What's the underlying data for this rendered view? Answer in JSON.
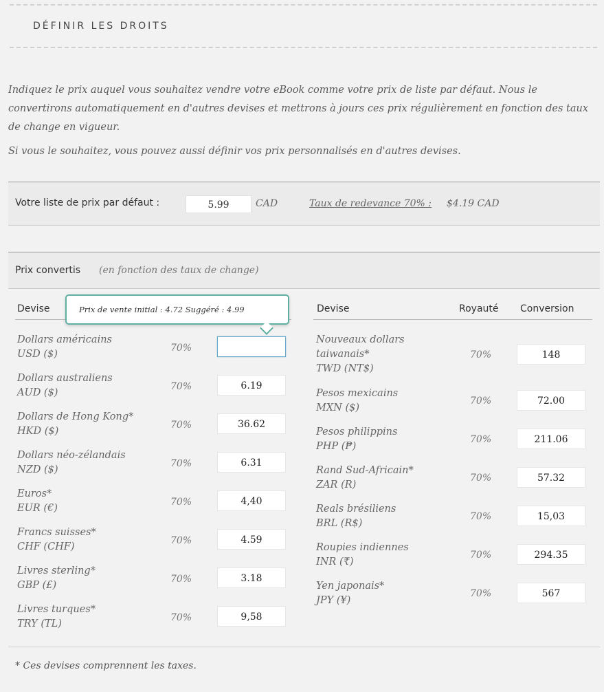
{
  "header": {
    "title": "DÉFINIR LES DROITS"
  },
  "intro": {
    "p1": "Indiquez le prix auquel vous souhaitez vendre votre eBook comme votre prix de liste par défaut. Nous le convertirons automatiquement en d'autres devises et mettrons à jours ces prix régulièrement en fonction des taux de change en vigueur.",
    "p2": "Si vous le souhaitez, vous pouvez aussi définir vos prix personnalisés en d'autres devises."
  },
  "default_price": {
    "label": "Votre liste de prix par défaut :",
    "value": "5.99",
    "currency": "CAD",
    "royalty_link": "Taux de redevance 70% :",
    "royalty_value": "$4.19 CAD"
  },
  "converted": {
    "label": "Prix convertis",
    "sublabel": "(en fonction des taux de change)",
    "headers": {
      "currency": "Devise",
      "royalty": "Royauté",
      "conversion": "Conversion"
    }
  },
  "tooltip": {
    "text": "Prix de vente initial : 4.72   Suggéré : 4.99"
  },
  "left_rows": [
    {
      "name1": "Dollars américains",
      "name2": "USD ($)",
      "pct": "70%",
      "value": ""
    },
    {
      "name1": "Dollars australiens",
      "name2": "AUD ($)",
      "pct": "70%",
      "value": "6.19"
    },
    {
      "name1": "Dollars de Hong Kong*",
      "name2": "HKD ($)",
      "pct": "70%",
      "value": "36.62"
    },
    {
      "name1": "Dollars néo-zélandais",
      "name2": "NZD ($)",
      "pct": "70%",
      "value": "6.31"
    },
    {
      "name1": "Euros*",
      "name2": "EUR (€)",
      "pct": "70%",
      "value": "4,40"
    },
    {
      "name1": "Francs suisses*",
      "name2": "CHF (CHF)",
      "pct": "70%",
      "value": "4.59"
    },
    {
      "name1": "Livres sterling*",
      "name2": "GBP (£)",
      "pct": "70%",
      "value": "3.18"
    },
    {
      "name1": "Livres turques*",
      "name2": "TRY (TL)",
      "pct": "70%",
      "value": "9,58"
    }
  ],
  "right_rows": [
    {
      "name1": "Nouveaux dollars",
      "name2": "taiwanais*",
      "name3": "TWD (NT$)",
      "pct": "70%",
      "value": "148"
    },
    {
      "name1": "Pesos mexicains",
      "name2": "MXN ($)",
      "pct": "70%",
      "value": "72.00"
    },
    {
      "name1": "Pesos philippins",
      "name2": "PHP (₱)",
      "pct": "70%",
      "value": "211.06"
    },
    {
      "name1": "Rand Sud-Africain*",
      "name2": "ZAR (R)",
      "pct": "70%",
      "value": "57.32"
    },
    {
      "name1": "Reals brésiliens",
      "name2": "BRL (R$)",
      "pct": "70%",
      "value": "15,03"
    },
    {
      "name1": "Roupies indiennes",
      "name2": "INR (₹)",
      "pct": "70%",
      "value": "294.35"
    },
    {
      "name1": "Yen japonais*",
      "name2": "JPY (¥)",
      "pct": "70%",
      "value": "567"
    }
  ],
  "footnote": "* Ces devises comprennent les taxes."
}
